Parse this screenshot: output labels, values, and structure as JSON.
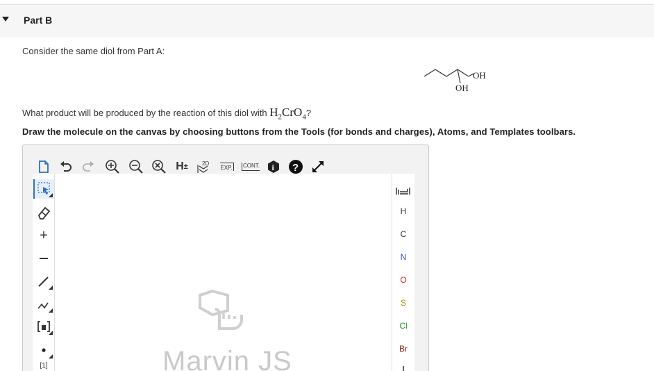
{
  "part": {
    "title": "Part B"
  },
  "intro": {
    "text": "Consider the same diol from Part A:"
  },
  "molecule": {
    "label_oh1": "OH",
    "label_oh2": "OH"
  },
  "question": {
    "prefix": "What product will be produced by the reaction of this diol with ",
    "formula_main": "H",
    "formula_sub1": "2",
    "formula_mid": "CrO",
    "formula_sub2": "4",
    "suffix": "?"
  },
  "instructions": {
    "text": "Draw  the molecule on the canvas by choosing buttons from the Tools (for bonds and charges), Atoms, and Templates toolbars."
  },
  "toolbar": {
    "h_label": "H",
    "h_sup": "±",
    "twod_label": "2D",
    "exp_label": "EXP.",
    "cont_label": "CONT.",
    "info_label": "i",
    "help_label": "?"
  },
  "left_tools": {
    "charge_plus": "+",
    "label_1": "[1]"
  },
  "atoms": [
    "H",
    "C",
    "N",
    "O",
    "S",
    "Cl",
    "Br"
  ],
  "colors": {
    "accent_blue": "#2a6fc4",
    "nitrogen": "#3050c8",
    "oxygen": "#e03020",
    "sulfur": "#b09000",
    "chlorine": "#1a9a1a",
    "bromine": "#8a2a1a"
  },
  "watermark": {
    "text": "Marvin JS"
  }
}
